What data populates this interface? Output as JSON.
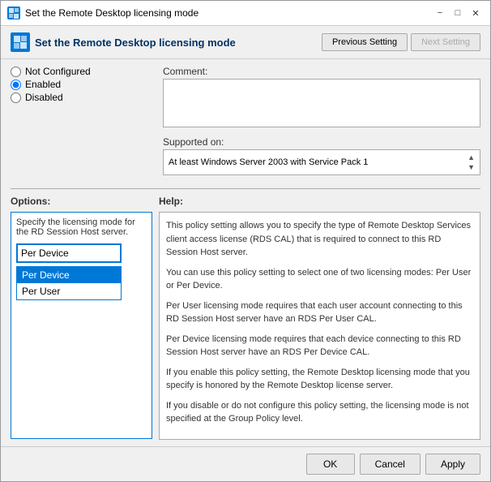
{
  "window": {
    "title": "Set the Remote Desktop licensing mode",
    "title_icon": "RD",
    "header_title": "Set the Remote Desktop licensing mode",
    "header_icon": "RD"
  },
  "header_buttons": {
    "previous": "Previous Setting",
    "next": "Next Setting"
  },
  "radio_options": {
    "not_configured": "Not Configured",
    "enabled": "Enabled",
    "disabled": "Disabled"
  },
  "comment_label": "Comment:",
  "supported_label": "Supported on:",
  "supported_value": "At least Windows Server 2003 with Service Pack 1",
  "sections": {
    "options_header": "Options:",
    "help_header": "Help:"
  },
  "options": {
    "description": "Specify the licensing mode for the RD Session Host server.",
    "dropdown_current": "Per Device",
    "items": [
      "Per Device",
      "Per User"
    ]
  },
  "help_paragraphs": [
    "This policy setting allows you to specify the type of Remote Desktop Services client access license (RDS CAL) that is required to connect to this RD Session Host server.",
    "You can use this policy setting to select one of two licensing modes: Per User or Per Device.",
    "Per User licensing mode requires that each user account connecting to this RD Session Host server have an RDS Per User CAL.",
    "Per Device licensing mode requires that each device connecting to this RD Session Host server have an RDS Per Device CAL.",
    "If you enable this policy setting, the Remote Desktop licensing mode that you specify is honored by the Remote Desktop license server.",
    "If you disable or do not configure this policy setting, the licensing mode is not specified at the Group Policy level."
  ],
  "footer": {
    "ok": "OK",
    "cancel": "Cancel",
    "apply": "Apply"
  }
}
